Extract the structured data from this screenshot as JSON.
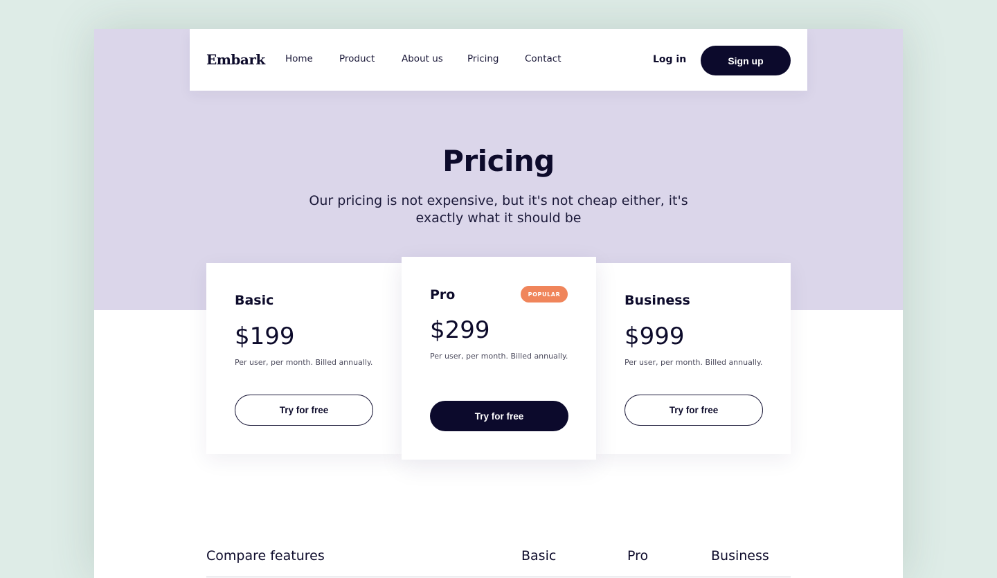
{
  "colors": {
    "background": "#deece7",
    "hero": "#dbd6ea",
    "primary": "#0c0a2c",
    "badge": "#f0855b",
    "text": "#0d0b2b"
  },
  "nav": {
    "logo": "Embark",
    "links": [
      "Home",
      "Product",
      "About us",
      "Pricing",
      "Contact"
    ],
    "login": "Log in",
    "signup": "Sign up"
  },
  "hero": {
    "title": "Pricing",
    "subtitle": "Our pricing is not expensive, but it's not cheap either, it's exactly what it should be"
  },
  "plans": [
    {
      "name": "Basic",
      "price": "$199",
      "billing": "Per user, per month. Billed annually.",
      "cta": "Try for free"
    },
    {
      "name": "Pro",
      "price": "$299",
      "billing": "Per user, per month. Billed annually.",
      "cta": "Try for free",
      "badge": "POPULAR"
    },
    {
      "name": "Business",
      "price": "$999",
      "billing": "Per user, per month. Billed annually.",
      "cta": "Try for free"
    }
  ],
  "compare": {
    "heading": "Compare features",
    "columns": [
      "Basic",
      "Pro",
      "Business"
    ]
  }
}
